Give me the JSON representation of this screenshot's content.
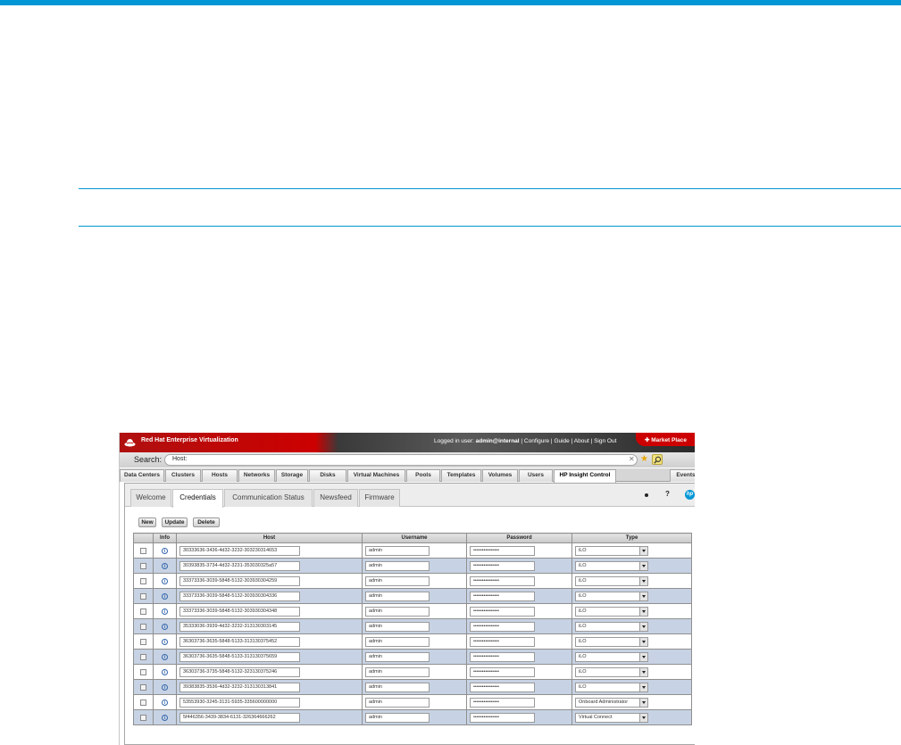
{
  "header": {
    "app_title": "Red Hat Enterprise Virtualization",
    "logged_in_prefix": "Logged in user:",
    "username": "admin@internal",
    "links": [
      "Configure",
      "Guide",
      "About",
      "Sign Out"
    ],
    "separator": "|",
    "market_label": "Market Place"
  },
  "search": {
    "label": "Search:",
    "value": "Host:"
  },
  "main_tabs": [
    "Data Centers",
    "Clusters",
    "Hosts",
    "Networks",
    "Storage",
    "Disks",
    "Virtual Machines",
    "Pools",
    "Templates",
    "Volumes",
    "Users",
    "HP Insight Control",
    "Events"
  ],
  "sub_tabs": [
    "Welcome",
    "Credentials",
    "Communication Status",
    "Newsfeed",
    "Firmware"
  ],
  "active_sub_tab": "Credentials",
  "actions": {
    "new": "New",
    "update": "Update",
    "delete": "Delete"
  },
  "table": {
    "columns": [
      "",
      "Info",
      "Host",
      "Username",
      "Password",
      "Type"
    ],
    "info_icon": "info-icon",
    "rows": [
      {
        "host": "30333636-3436-4d32-3232-303230314653",
        "username": "admin",
        "password": "•••••••••••••••",
        "type": "iLO"
      },
      {
        "host": "30393835-3734-4d32-3231-353030325a57",
        "username": "admin",
        "password": "•••••••••••••••",
        "type": "iLO"
      },
      {
        "host": "33373336-3039-5848-5132-303930304259",
        "username": "admin",
        "password": "•••••••••••••••",
        "type": "iLO"
      },
      {
        "host": "33373336-3039-5848-5132-303930304336",
        "username": "admin",
        "password": "•••••••••••••••",
        "type": "iLO"
      },
      {
        "host": "33373336-3039-5848-5132-303930304348",
        "username": "admin",
        "password": "•••••••••••••••",
        "type": "iLO"
      },
      {
        "host": "35333036-3939-4d32-3232-313130303145",
        "username": "admin",
        "password": "•••••••••••••••",
        "type": "iLO"
      },
      {
        "host": "36303736-3635-5848-5133-313130375452",
        "username": "admin",
        "password": "•••••••••••••••",
        "type": "iLO"
      },
      {
        "host": "36303736-3635-5848-5133-313130375659",
        "username": "admin",
        "password": "•••••••••••••••",
        "type": "iLO"
      },
      {
        "host": "36303736-3735-5848-5132-323130375246",
        "username": "admin",
        "password": "•••••••••••••••",
        "type": "iLO"
      },
      {
        "host": "39383835-3536-4d32-3232-313130313841",
        "username": "admin",
        "password": "•••••••••••••••",
        "type": "iLO"
      },
      {
        "host": "53553930-3245-3131-5935-335600000000",
        "username": "admin",
        "password": "•••••••••••••••",
        "type": "Onboard Administrator"
      },
      {
        "host": "5f446356-3439-3834-6131-326364666262",
        "username": "admin",
        "password": "•••••••••••••••",
        "type": "Virtual Connect"
      }
    ]
  },
  "colors": {
    "doc_accent": "#0096d6",
    "brand_red": "#cc0000",
    "row_alt": "#c7d3e4"
  }
}
